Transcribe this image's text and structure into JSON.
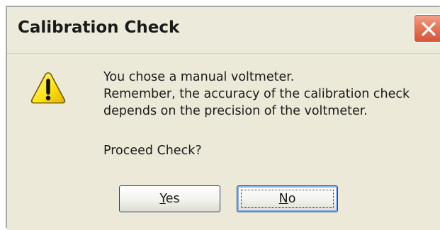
{
  "window": {
    "title": "Calibration Check",
    "close_icon": "close-icon"
  },
  "message": {
    "icon": "warning-icon",
    "lines": [
      "You chose a manual voltmeter.",
      "Remember, the accuracy of the calibration check",
      "depends on the precision of the voltmeter."
    ],
    "prompt": "Proceed Check?"
  },
  "buttons": {
    "yes": {
      "mnemonic": "Y",
      "rest": "es"
    },
    "no": {
      "mnemonic": "N",
      "rest": "o",
      "focused": true
    }
  },
  "colors": {
    "dialog_bg": "#ece9d8",
    "close_button": "#e8785a",
    "button_border": "#1c3e8c",
    "warning_yellow": "#ffe419"
  }
}
